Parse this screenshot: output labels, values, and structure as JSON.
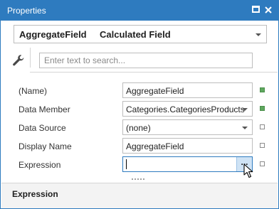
{
  "window": {
    "title": "Properties"
  },
  "object_selector": {
    "name": "AggregateField",
    "type": "Calculated Field"
  },
  "search": {
    "placeholder": "Enter text to search..."
  },
  "properties": [
    {
      "label": "(Name)",
      "value": "AggregateField",
      "has_dropdown": false,
      "modified": true
    },
    {
      "label": "Data Member",
      "value": "Categories.CategoriesProducts",
      "has_dropdown": true,
      "modified": true
    },
    {
      "label": "Data Source",
      "value": "(none)",
      "has_dropdown": true,
      "modified": false
    },
    {
      "label": "Display Name",
      "value": "AggregateField",
      "has_dropdown": false,
      "modified": false
    },
    {
      "label": "Expression",
      "value": "",
      "has_dropdown": false,
      "modified": false,
      "editor_button": "..."
    }
  ],
  "description": {
    "title": "Expression"
  },
  "colors": {
    "accent": "#2e7bbf",
    "modified_marker": "#5fa85f",
    "editor_button_bg": "#cfe3f5"
  }
}
